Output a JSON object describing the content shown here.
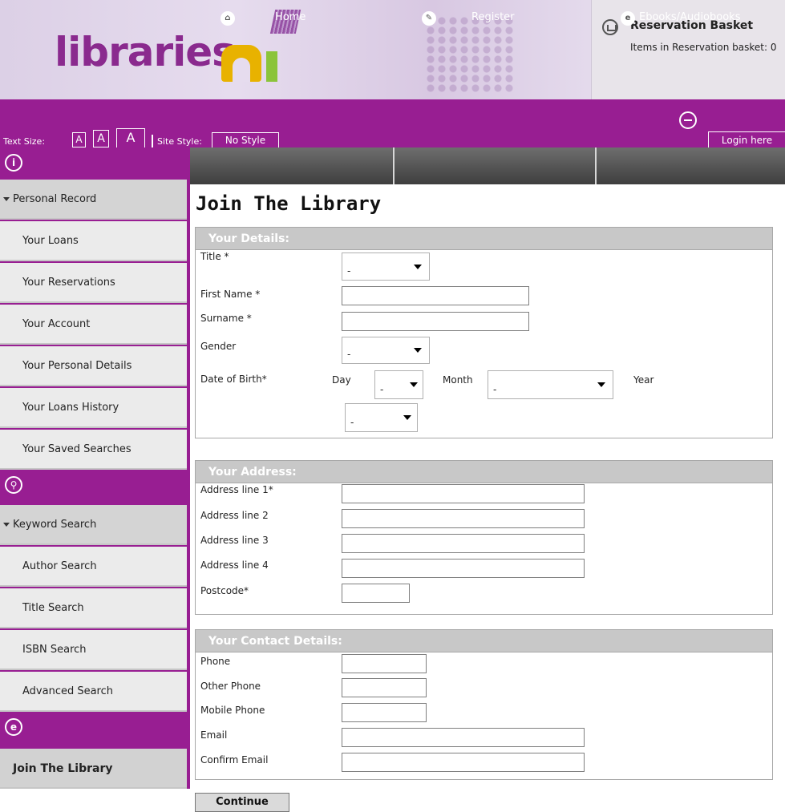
{
  "header": {
    "logo_text": "libraries",
    "logo_suffix": "ni",
    "basket_title": "Reservation Basket",
    "basket_count_label": "Items in Reservation basket: 0"
  },
  "toolbar": {
    "text_size_label": "Text Size:",
    "size_small": "A",
    "size_medium": "A",
    "size_large": "A",
    "site_style_label": "Site Style:",
    "site_style_value": "No Style",
    "login_label": "Login here"
  },
  "sidebar": {
    "personal_record": "Personal Record",
    "account_items": [
      "Your Loans",
      "Your Reservations",
      "Your Account",
      "Your Personal Details",
      "Your Loans History",
      "Your Saved Searches"
    ],
    "keyword_search": "Keyword Search",
    "search_items": [
      "Author Search",
      "Title Search",
      "ISBN Search",
      "Advanced Search"
    ],
    "join_library": "Join The Library"
  },
  "nav": {
    "home": "Home",
    "register": "Register",
    "ebooks": "Ebooks/Audiobooks"
  },
  "page": {
    "title": "Join The Library",
    "continue_label": "Continue"
  },
  "details": {
    "heading": "Your Details:",
    "title_label": "Title *",
    "title_value": "-",
    "first_name_label": "First Name *",
    "first_name_value": "",
    "surname_label": "Surname *",
    "surname_value": "",
    "gender_label": "Gender",
    "gender_value": "-",
    "dob_label": "Date of Birth*",
    "day_label": "Day",
    "day_value": "-",
    "month_label": "Month",
    "month_value": "-",
    "year_label": "Year",
    "year_value": "-"
  },
  "address": {
    "heading": "Your Address:",
    "line1_label": "Address line 1*",
    "line2_label": "Address line 2",
    "line3_label": "Address line 3",
    "line4_label": "Address line 4",
    "postcode_label": "Postcode*"
  },
  "contact": {
    "heading": "Your Contact Details:",
    "phone_label": "Phone",
    "other_phone_label": "Other Phone",
    "mobile_label": "Mobile Phone",
    "email_label": "Email",
    "confirm_email_label": "Confirm Email"
  },
  "colors": {
    "brand_purple": "#981e92",
    "sidebar_item_bg": "#ebebeb",
    "section_header_bg": "#c8c8c8",
    "nav_bg": "#4e4e4e"
  }
}
